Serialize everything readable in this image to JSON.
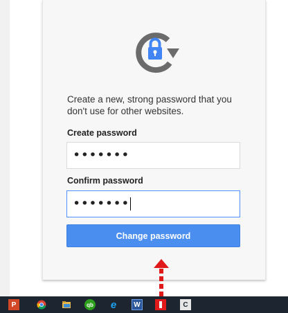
{
  "form": {
    "instructions": "Create a new, strong password that you don't use for other websites.",
    "create_label": "Create password",
    "create_value": "•••••••",
    "confirm_label": "Confirm password",
    "confirm_value": "•••••••",
    "submit_label": "Change password"
  },
  "colors": {
    "accent": "#4a8ef0",
    "logo_gray": "#6b6b6b",
    "logo_blue": "#4285f4",
    "arrow_red": "#e01a1a"
  },
  "taskbar": {
    "apps": [
      {
        "icon": "powerpoint-icon",
        "letter": "P"
      },
      {
        "icon": "chrome-icon"
      },
      {
        "icon": "file-explorer-icon"
      },
      {
        "icon": "quickbooks-icon",
        "letter": "qb"
      },
      {
        "icon": "internet-explorer-icon",
        "letter": "e"
      },
      {
        "icon": "word-icon",
        "letter": "W"
      },
      {
        "icon": "red-app-icon"
      },
      {
        "icon": "c-app-icon",
        "letter": "C"
      }
    ]
  }
}
